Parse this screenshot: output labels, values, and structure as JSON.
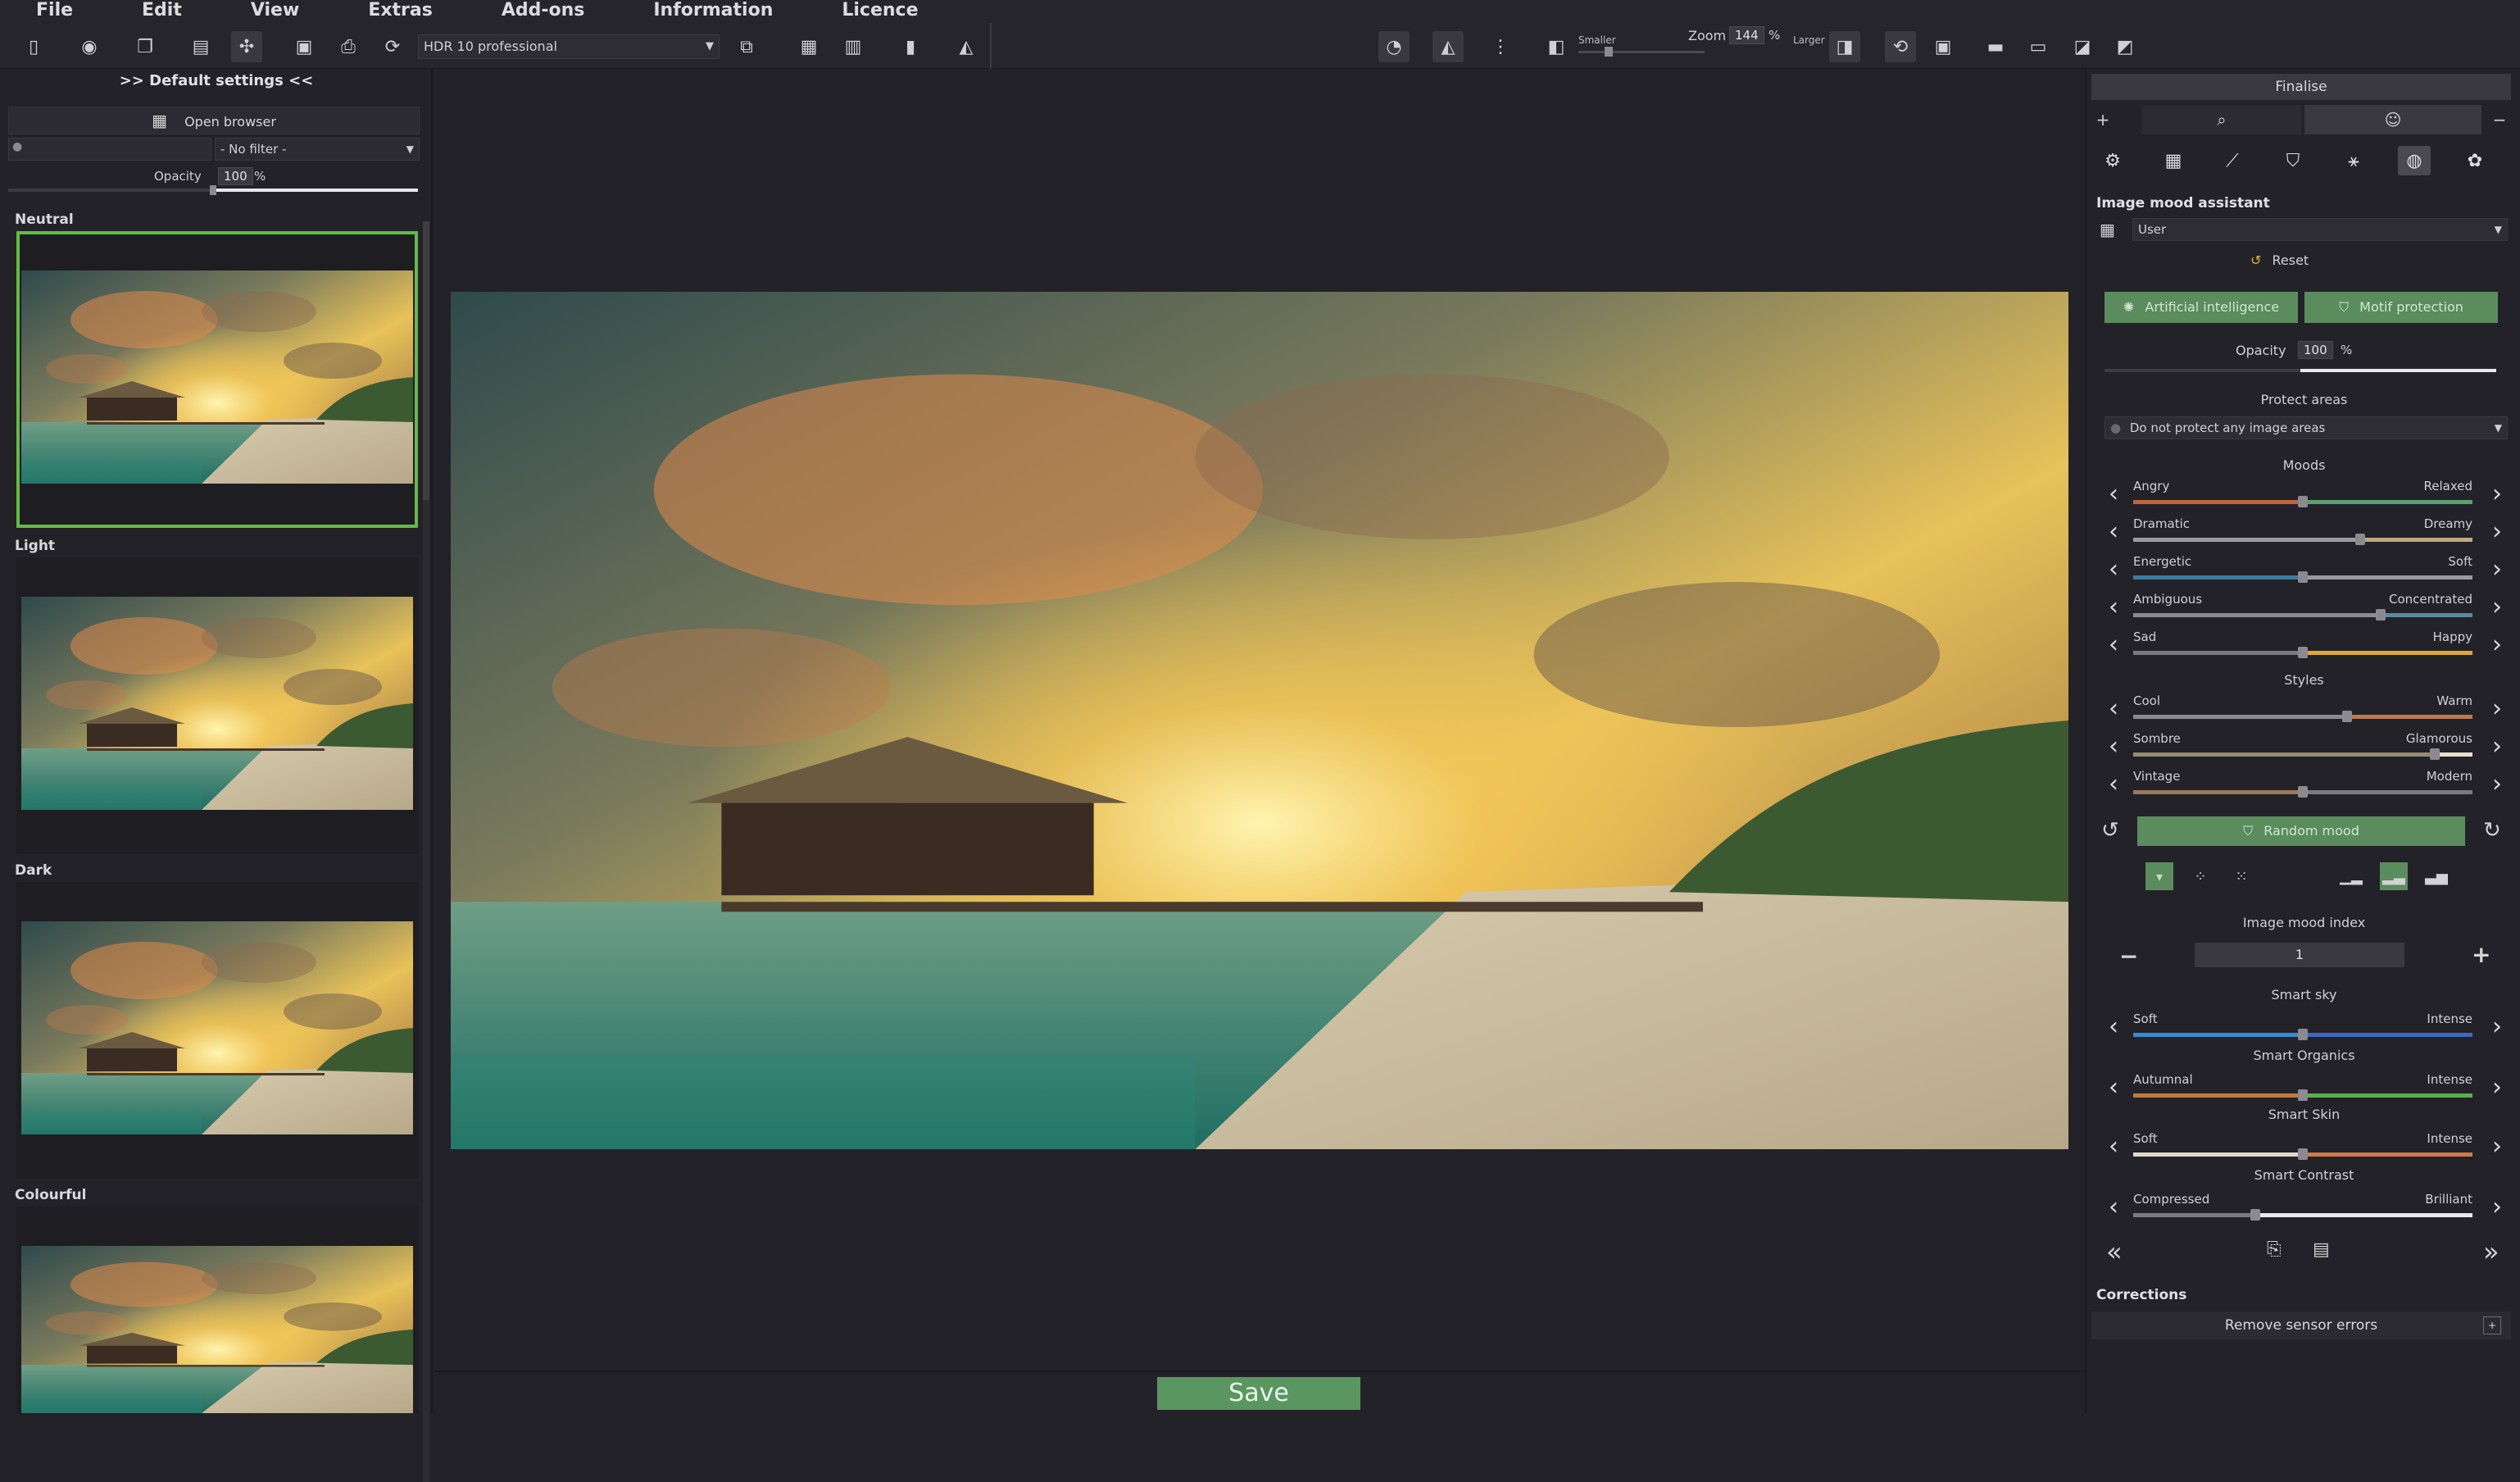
{
  "menubar": {
    "items": [
      "File",
      "Edit",
      "View",
      "Extras",
      "Add-ons",
      "Information",
      "Licence"
    ]
  },
  "toolbar": {
    "preset": "HDR 10 professional",
    "zoom_smaller": "Smaller",
    "zoom_label": "Zoom",
    "zoom_value": "144",
    "zoom_unit": "%",
    "zoom_larger": "Larger"
  },
  "left_panel": {
    "header": ">> Default settings <<",
    "open_browser": "Open browser",
    "filter": "- No filter -",
    "opacity_label": "Opacity",
    "opacity_value": "100",
    "opacity_unit": "%",
    "presets": [
      {
        "label": "Neutral",
        "selected": true
      },
      {
        "label": "Light",
        "selected": false
      },
      {
        "label": "Dark",
        "selected": false
      },
      {
        "label": "Colourful",
        "selected": false
      }
    ]
  },
  "main": {
    "save_label": "Save"
  },
  "right_panel": {
    "finalise": "Finalise",
    "section_title": "Image mood assistant",
    "user_select": "User",
    "reset": "Reset",
    "ai_button": "Artificial intelligence",
    "motif_button": "Motif protection",
    "opacity_label": "Opacity",
    "opacity_value": "100",
    "opacity_unit": "%",
    "protect_title": "Protect areas",
    "protect_select": "Do not protect any image areas",
    "moods_title": "Moods",
    "moods": [
      {
        "left": "Angry",
        "right": "Relaxed",
        "value": 0.5
      },
      {
        "left": "Dramatic",
        "right": "Dreamy",
        "value": 0.67
      },
      {
        "left": "Energetic",
        "right": "Soft",
        "value": 0.5
      },
      {
        "left": "Ambiguous",
        "right": "Concentrated",
        "value": 0.73
      },
      {
        "left": "Sad",
        "right": "Happy",
        "value": 0.5
      }
    ],
    "styles_title": "Styles",
    "styles": [
      {
        "left": "Cool",
        "right": "Warm",
        "value": 0.63
      },
      {
        "left": "Sombre",
        "right": "Glamorous",
        "value": 0.89
      },
      {
        "left": "Vintage",
        "right": "Modern",
        "value": 0.5
      }
    ],
    "random_mood": "Random mood",
    "mood_index_title": "Image mood index",
    "mood_index_value": "1",
    "smart_sky_title": "Smart sky",
    "smart_sky": {
      "left": "Soft",
      "right": "Intense",
      "value": 0.5
    },
    "smart_organics_title": "Smart Organics",
    "smart_organics": {
      "left": "Autumnal",
      "right": "Intense",
      "value": 0.5
    },
    "smart_skin_title": "Smart Skin",
    "smart_skin": {
      "left": "Soft",
      "right": "Intense",
      "value": 0.5
    },
    "smart_contrast_title": "Smart Contrast",
    "smart_contrast": {
      "left": "Compressed",
      "right": "Brilliant",
      "value": 0.36
    },
    "corrections_title": "Corrections",
    "remove_sensor": "Remove sensor errors"
  },
  "colors": {
    "accent_green": "#5fbe40",
    "button_green": "#5a9660"
  },
  "icons": [
    "new-file-icon",
    "open-icon",
    "copy-icon",
    "image-icon",
    "magic-icon",
    "save-icon",
    "print-icon",
    "refresh-icon",
    "eye-icon",
    "compare-icon",
    "zoom-icon",
    "search-icon",
    "smiley-icon",
    "gear-icon",
    "reset-icon",
    "brain-icon",
    "shield-icon",
    "chevron-left-icon",
    "chevron-right-icon",
    "undo-icon",
    "redo-icon",
    "minus-icon",
    "plus-icon"
  ]
}
